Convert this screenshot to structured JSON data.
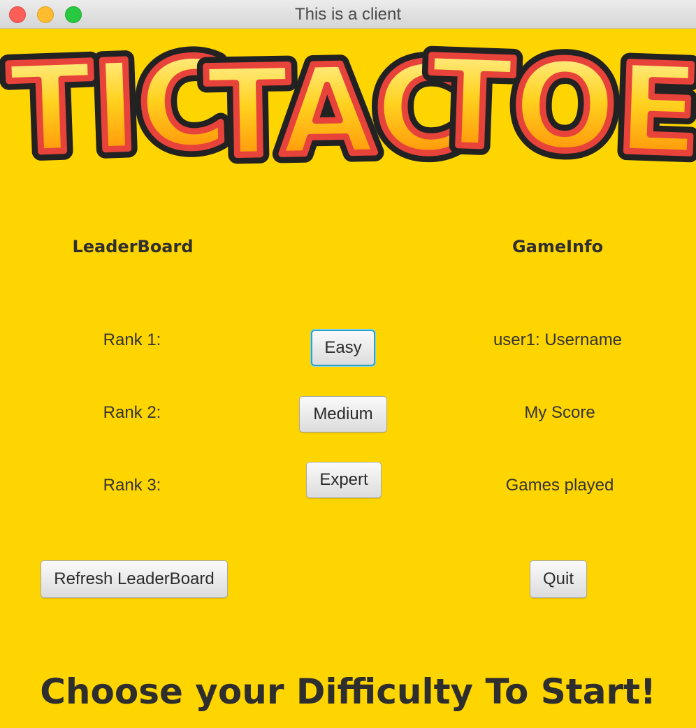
{
  "window": {
    "title": "This is a client"
  },
  "logo": {
    "text": "TIC TAC TOE",
    "word1": "TIC",
    "word2": "TAC",
    "word3": "TOE"
  },
  "leaderboard": {
    "heading": "LeaderBoard",
    "ranks": [
      "Rank 1:",
      "Rank 2:",
      "Rank 3:"
    ],
    "refresh_label": "Refresh LeaderBoard"
  },
  "difficulty": {
    "easy_label": "Easy",
    "medium_label": "Medium",
    "expert_label": "Expert",
    "focused": "Easy"
  },
  "gameinfo": {
    "heading": "GameInfo",
    "username": "user1: Username",
    "score": "My Score",
    "games_played": "Games played",
    "quit_label": "Quit"
  },
  "footer": {
    "prompt": "Choose your Difficulty To Start!"
  },
  "colors": {
    "background": "#ffd500",
    "focus_ring": "#2ba3c8",
    "logo_fill_top": "#fff38a",
    "logo_fill_bottom": "#ff8a00",
    "logo_outline": "#e8433a"
  }
}
